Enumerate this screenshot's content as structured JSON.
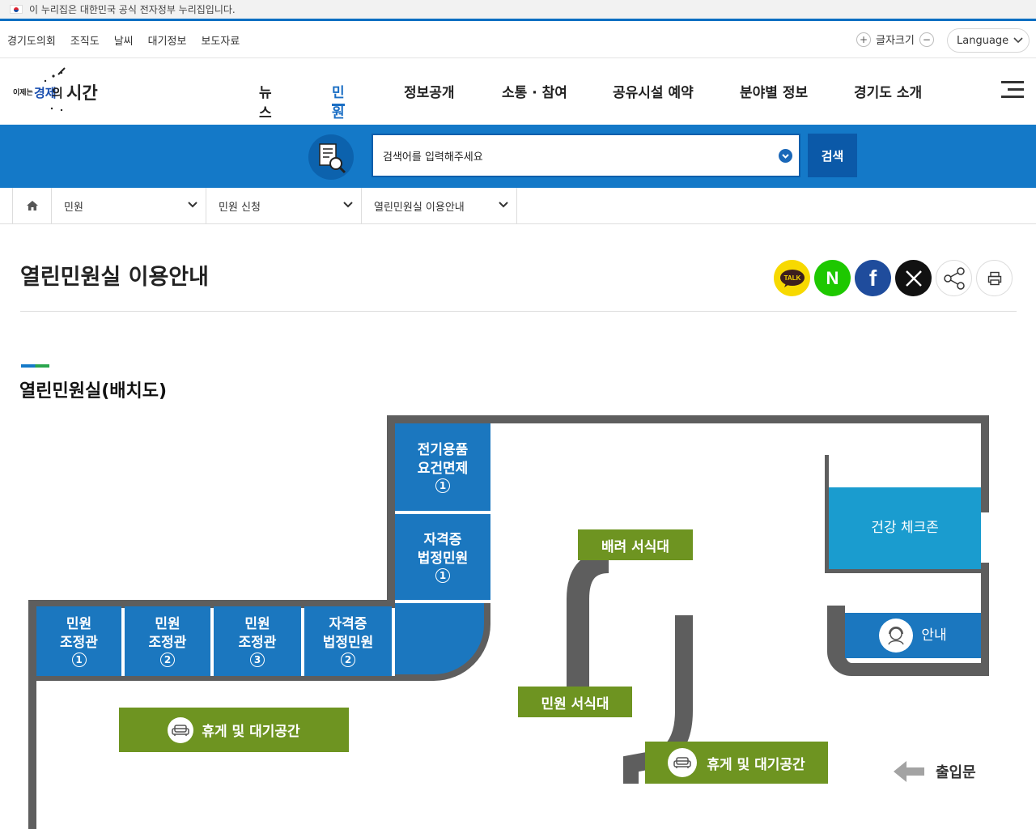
{
  "banner": {
    "text": "이 누리집은 대한민국 공식 전자정부 누리집입니다."
  },
  "util": {
    "links": [
      "경기도의회",
      "조직도",
      "날씨",
      "대기정보",
      "보도자료"
    ],
    "fontsize_label": "글자크기",
    "fontsize_plus": "+",
    "fontsize_minus": "−",
    "language_label": "Language"
  },
  "header": {
    "logo_text": "이제는 경제의 시간",
    "nav": [
      "뉴스",
      "민원",
      "정보공개",
      "소통 · 참여",
      "공유시설 예약",
      "분야별 정보",
      "경기도 소개"
    ],
    "active_nav": "민원"
  },
  "search": {
    "placeholder": "검색어를 입력해주세요",
    "button_label": "검색"
  },
  "breadcrumb": {
    "items": [
      "민원",
      "민원 신청",
      "열린민원실 이용안내"
    ]
  },
  "page": {
    "title": "열린민원실 이용안내",
    "section_title": "열린민원실(배치도)"
  },
  "share": {
    "kakao_label": "TALK",
    "naver_label": "N",
    "facebook_label": "f",
    "x_label": "X"
  },
  "floorplan": {
    "rooms_top": [
      {
        "line1": "전기용품",
        "line2": "요건면제",
        "num": "1"
      },
      {
        "line1": "자격증",
        "line2": "법정민원",
        "num": "1"
      }
    ],
    "rooms_bottom": [
      {
        "line1": "민원",
        "line2": "조정관",
        "num": "1"
      },
      {
        "line1": "민원",
        "line2": "조정관",
        "num": "2"
      },
      {
        "line1": "민원",
        "line2": "조정관",
        "num": "3"
      },
      {
        "line1": "자격증",
        "line2": "법정민원",
        "num": "2"
      }
    ],
    "health_zone": "건강 체크존",
    "info_desk": "안내",
    "accessible_desk": "배려 서식대",
    "form_desk": "민원 서식대",
    "rest_area_left": "휴게 및 대기공간",
    "rest_area_right": "휴게 및 대기공간",
    "entrance": "출입문"
  },
  "colors": {
    "primary_blue": "#1479c8",
    "room_blue": "#1b77bf",
    "health_cyan": "#1a9ccf",
    "desk_green": "#6e9421",
    "wall_gray": "#5e5e5e"
  }
}
